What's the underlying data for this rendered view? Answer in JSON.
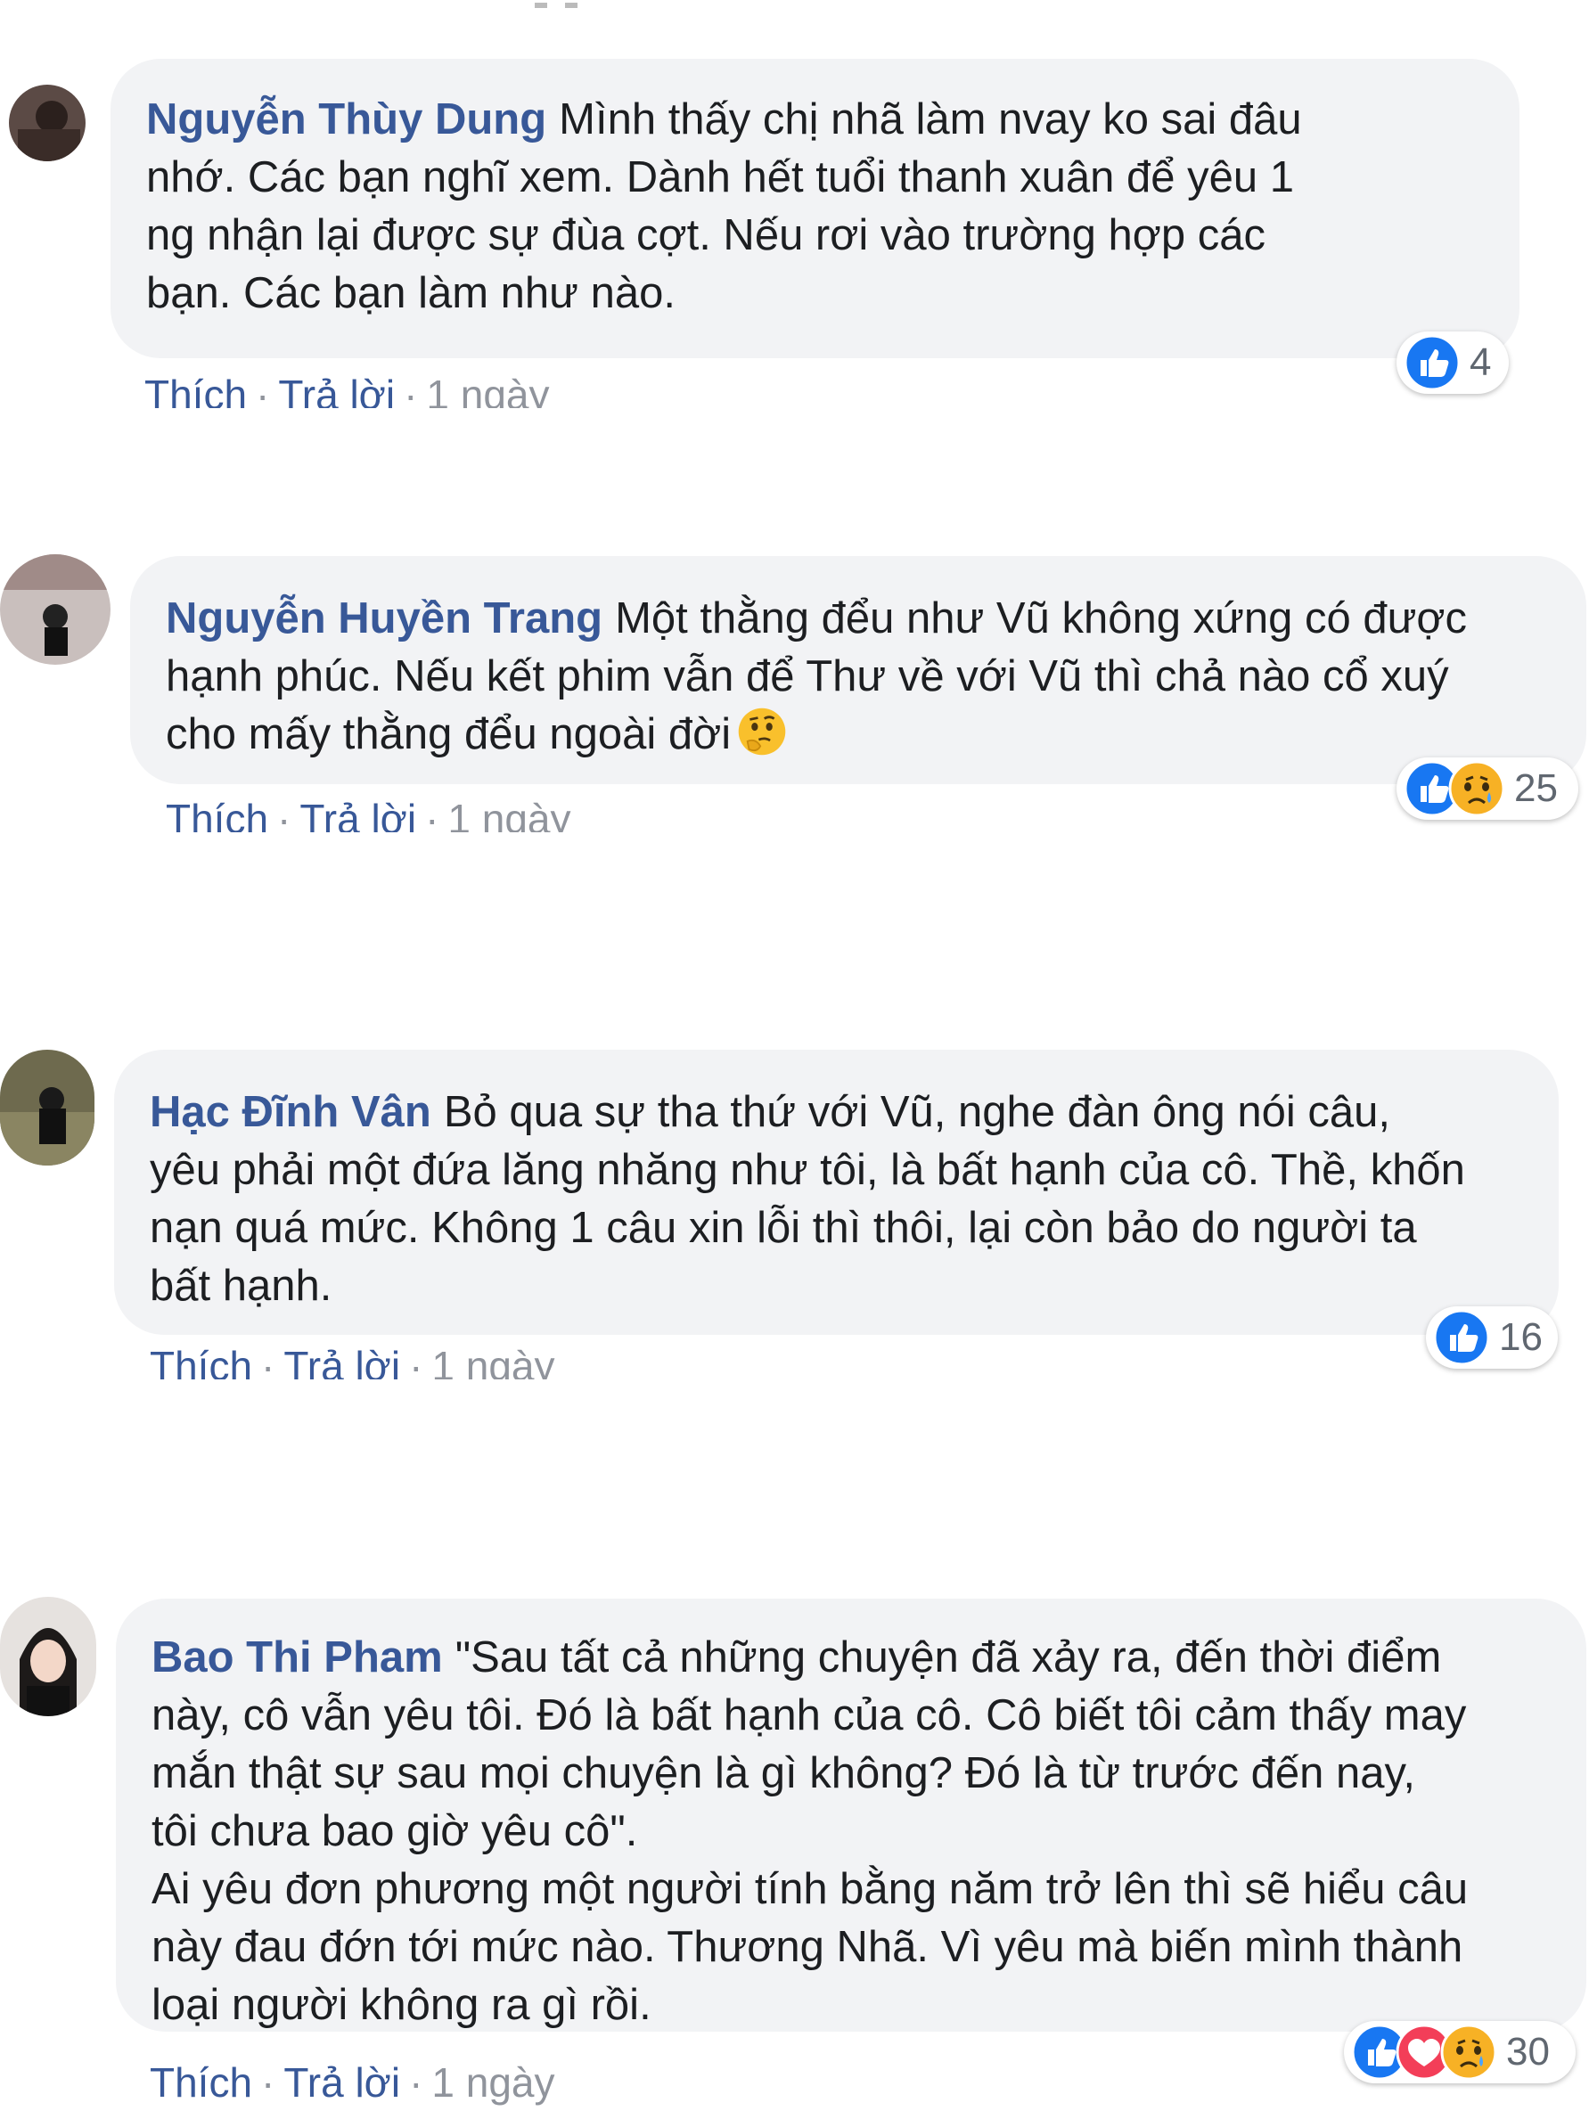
{
  "comments": [
    {
      "author": "Nguyễn Thùy Dung",
      "lines": [
        "Mình thấy chị nhã làm nvay ko sai đâu",
        "nhớ. Các bạn nghĩ xem. Dành hết tuổi thanh xuân để yêu 1",
        "ng nhận lại được sự đùa cợt. Nếu rơi vào trường hợp các",
        "bạn. Các bạn làm như nào."
      ],
      "reaction_count": "4",
      "reactions": [
        "like-icon"
      ],
      "like_label": "Thích",
      "reply_label": "Trả lời",
      "time": "1 ngày"
    },
    {
      "author": "Nguyễn Huyền Trang",
      "lines": [
        "Một thằng đểu như Vũ không xứng có được",
        "hạnh phúc. Nếu kết phim vẫn để Thư về với Vũ thì chả nào cổ xuý",
        "cho mấy thằng đểu ngoài đời"
      ],
      "reaction_count": "25",
      "reactions": [
        "like-icon",
        "sad-icon"
      ],
      "inline_emoji": "thinking-face-icon",
      "like_label": "Thích",
      "reply_label": "Trả lời",
      "time": "1 ngày"
    },
    {
      "author": "Hạc Đĩnh Vân",
      "lines": [
        "Bỏ qua sự tha thứ với Vũ, nghe đàn ông nói câu,",
        "yêu phải một đứa lăng nhăng như tôi, là bất hạnh của cô. Thề, khốn",
        "nạn quá mức. Không 1 câu xin lỗi thì thôi, lại còn bảo do người ta",
        "bất hạnh."
      ],
      "reaction_count": "16",
      "reactions": [
        "like-icon"
      ],
      "like_label": "Thích",
      "reply_label": "Trả lời",
      "time": "1 ngày"
    },
    {
      "author": "Bao Thi Pham",
      "lines": [
        "\"Sau tất cả những chuyện đã xảy ra, đến thời điểm",
        "này, cô vẫn yêu tôi. Đó là bất hạnh của cô. Cô biết tôi cảm thấy may",
        "mắn thật sự sau mọi chuyện là gì không? Đó là từ trước đến nay,",
        "tôi chưa bao giờ yêu cô\".",
        "Ai yêu đơn phương một người tính bằng năm trở lên thì sẽ hiểu câu",
        "này đau đớn tới mức nào. Thương Nhã. Vì yêu mà biến mình thành",
        "loại người không ra gì rồi."
      ],
      "reaction_count": "30",
      "reactions": [
        "like-icon",
        "love-icon",
        "sad-icon"
      ],
      "like_label": "Thích",
      "reply_label": "Trả lời",
      "time": "1 ngày"
    }
  ],
  "colors": {
    "author": "#385898",
    "bubble": "#f2f3f5",
    "text": "#1c1e21",
    "muted": "#90949c",
    "like": "#1877f2"
  }
}
